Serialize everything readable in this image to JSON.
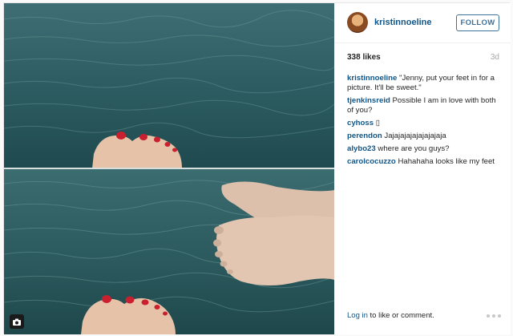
{
  "post": {
    "author": "kristinnoeline",
    "follow_label": "FOLLOW",
    "likes": "338 likes",
    "age": "3d"
  },
  "comments": [
    {
      "user": "kristinnoeline",
      "text": "\"Jenny, put your feet in for a picture. It'll be sweet.\""
    },
    {
      "user": "tjenkinsreid",
      "text": "Possible I am in love with both of you?"
    },
    {
      "user": "cyhoss",
      "text": "▯"
    },
    {
      "user": "perendon",
      "text": "Jajajajajajajajajaja"
    },
    {
      "user": "alybo23",
      "text": "where are you guys?"
    },
    {
      "user": "carolcocuzzo",
      "text": "Hahahaha looks like my feet"
    }
  ],
  "footer": {
    "login_link": "Log in",
    "login_rest": " to like or comment."
  },
  "icons": {
    "photo_badge": "camera-icon",
    "more": "more-options-icon"
  },
  "colors": {
    "link_blue": "#125688",
    "follow_blue": "#3f729b",
    "water": "#2b5a60"
  }
}
